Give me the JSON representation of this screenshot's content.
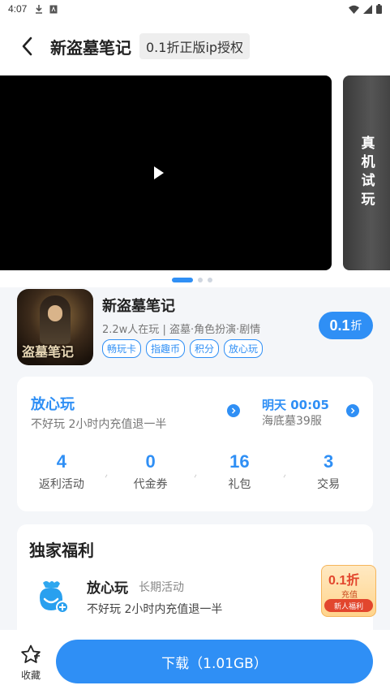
{
  "status_bar": {
    "time": "4:07",
    "icons": [
      "download-icon",
      "a-icon",
      "wifi-icon",
      "signal-icon",
      "battery-icon"
    ]
  },
  "header": {
    "title": "新盗墓笔记",
    "badge": "0.1折正版ip授权"
  },
  "media": {
    "trial_label": "真机试玩",
    "carousel_count": 3,
    "carousel_active": 0
  },
  "game": {
    "name": "新盗墓笔记",
    "icon_text": "盗墓笔记",
    "meta": "2.2w人在玩 | 盗墓·角色扮演·剧情",
    "tags": [
      "畅玩卡",
      "指趣币",
      "积分",
      "放心玩"
    ],
    "discount_value": "0.1",
    "discount_unit": "折"
  },
  "fangxin": {
    "title": "放心玩",
    "desc": "不好玩 2小时内充值退一半",
    "server_time": "明天 00:05",
    "server_name": "海底墓39服"
  },
  "stats": [
    {
      "value": "4",
      "label": "返利活动"
    },
    {
      "value": "0",
      "label": "代金券"
    },
    {
      "value": "16",
      "label": "礼包"
    },
    {
      "value": "3",
      "label": "交易"
    }
  ],
  "welfare": {
    "section_title": "独家福利",
    "item_name": "放心玩",
    "item_sub": "长期活动",
    "item_desc": "不好玩 2小时内充值退一半",
    "badge_big": "0.1折",
    "badge_small": "充值",
    "badge_ribbon": "新人福利"
  },
  "bottom": {
    "favorite_label": "收藏",
    "download_label": "下载（1.01GB）"
  },
  "colors": {
    "accent": "#2f8ff5",
    "background": "#f4f6f9",
    "badge_red": "#e2462d"
  }
}
